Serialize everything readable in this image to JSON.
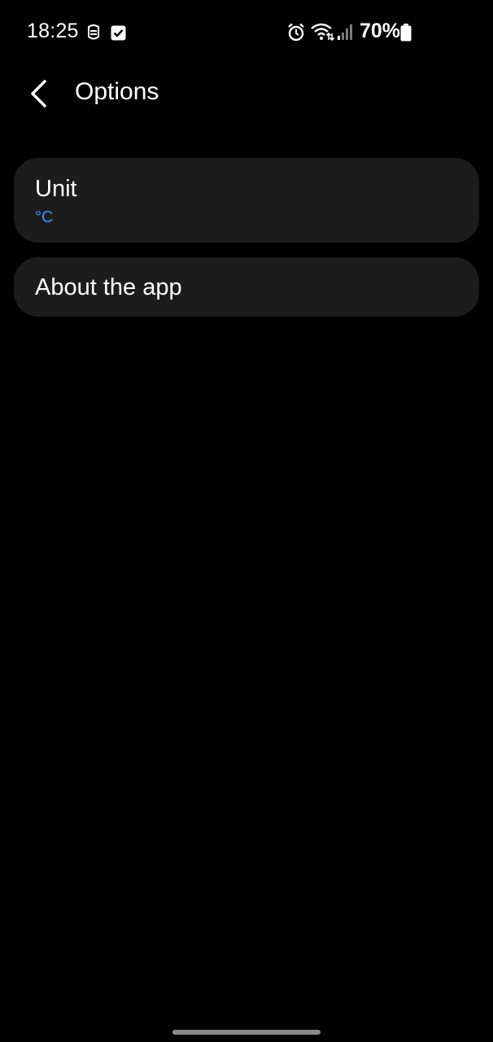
{
  "status_bar": {
    "time": "18:25",
    "battery_percent": "70%",
    "icons": [
      "notification-app-icon",
      "checkbox-notification-icon",
      "alarm-icon",
      "wifi-icon",
      "signal-icon",
      "battery-icon"
    ]
  },
  "header": {
    "title": "Options",
    "back_icon": "chevron-left-icon"
  },
  "settings": {
    "items": [
      {
        "title": "Unit",
        "value": "°C"
      },
      {
        "title": "About the app"
      }
    ]
  },
  "colors": {
    "background": "#000000",
    "card": "#1c1c1c",
    "accent": "#3e91ff",
    "text": "#ffffff"
  }
}
